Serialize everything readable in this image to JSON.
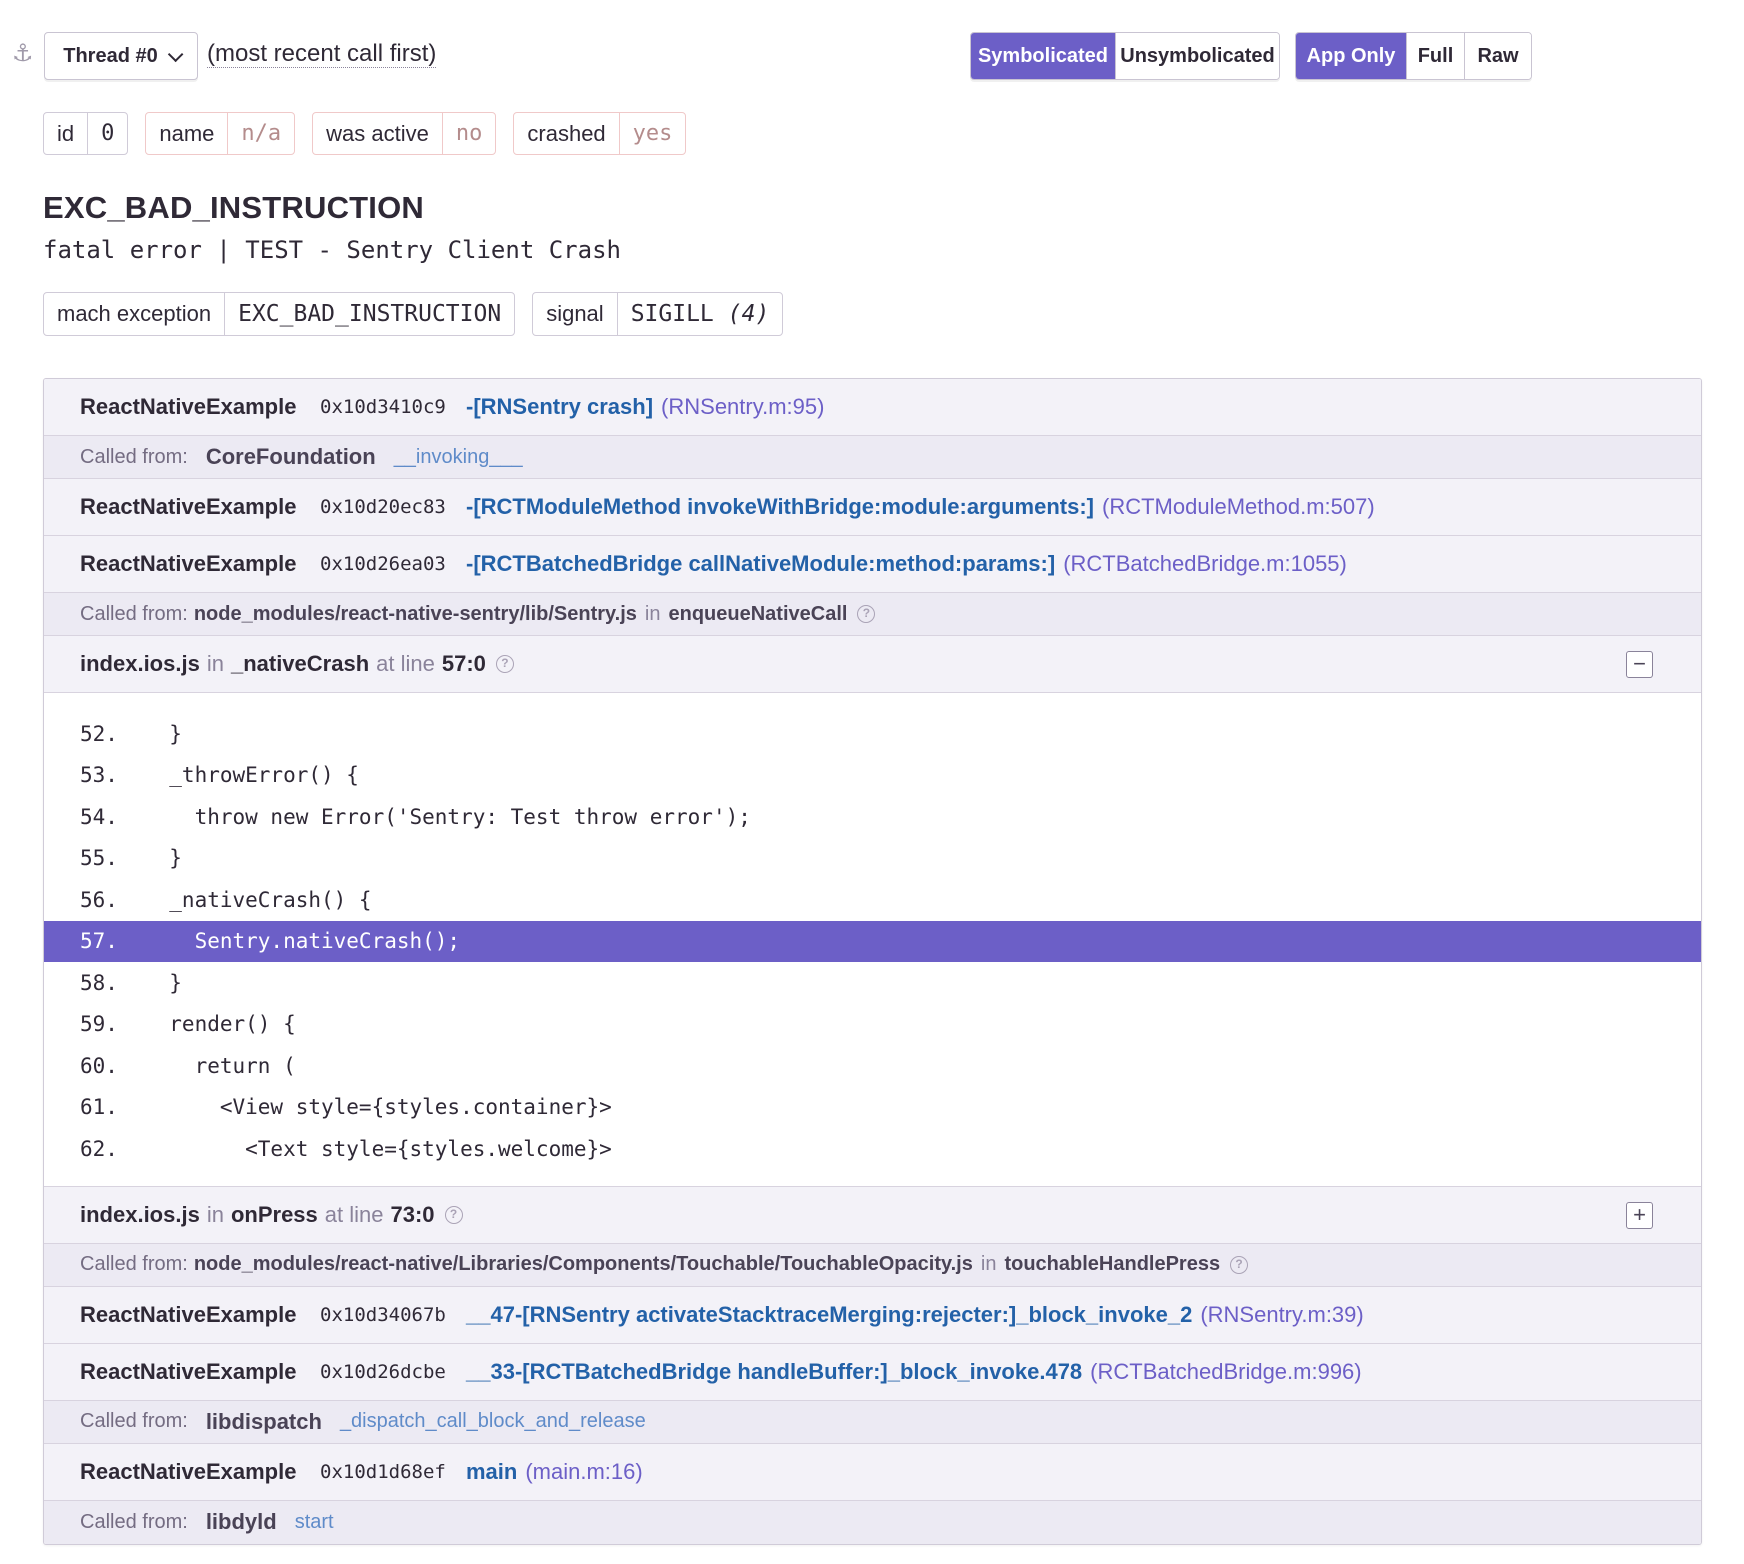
{
  "header": {
    "thread_label": "Thread #0",
    "order_note": "(most recent call first)",
    "view_modes": [
      "Symbolicated",
      "Unsymbolicated"
    ],
    "view_mode_active": "Symbolicated",
    "filter_modes": [
      "App Only",
      "Full",
      "Raw"
    ],
    "filter_mode_active": "App Only",
    "accent_color": "#6c5fc7"
  },
  "thread_info": [
    {
      "key": "id",
      "value": "0",
      "state": "plain"
    },
    {
      "key": "name",
      "value": "n/a",
      "state": "bad"
    },
    {
      "key": "was active",
      "value": "no",
      "state": "bad"
    },
    {
      "key": "crashed",
      "value": "yes",
      "state": "bad"
    }
  ],
  "exception": {
    "type": "EXC_BAD_INSTRUCTION",
    "value": "fatal error | TEST - Sentry Client Crash",
    "mechanism": [
      {
        "key": "mach exception",
        "value": "EXC_BAD_INSTRUCTION",
        "extra": ""
      },
      {
        "key": "signal",
        "value": "SIGILL",
        "extra": "(4)"
      }
    ]
  },
  "frames": {
    "called_from_label": "Called from:",
    "in_label": "in",
    "at_line_label": "at line",
    "f1": {
      "package": "ReactNativeExample",
      "address": "0x10d3410c9",
      "function": "-[RNSentry crash]",
      "location": "(RNSentry.m:95)"
    },
    "c1": {
      "package": "CoreFoundation",
      "function": "__invoking___"
    },
    "f2": {
      "package": "ReactNativeExample",
      "address": "0x10d20ec83",
      "function": "-[RCTModuleMethod invokeWithBridge:module:arguments:]",
      "location": "(RCTModuleMethod.m:507)"
    },
    "f3": {
      "package": "ReactNativeExample",
      "address": "0x10d26ea03",
      "function": "-[RCTBatchedBridge callNativeModule:method:params:]",
      "location": "(RCTBatchedBridge.m:1055)"
    },
    "c3": {
      "path": "node_modules/react-native-sentry/lib/Sentry.js",
      "function": "enqueueNativeCall"
    },
    "f4": {
      "file": "index.ios.js",
      "function": "_nativeCrash",
      "line": "57:0",
      "toggle": "−"
    },
    "code": [
      {
        "num": "52.",
        "text": "  }"
      },
      {
        "num": "53.",
        "text": "  _throwError() {"
      },
      {
        "num": "54.",
        "text": "    throw new Error('Sentry: Test throw error');"
      },
      {
        "num": "55.",
        "text": "  }"
      },
      {
        "num": "56.",
        "text": "  _nativeCrash() {"
      },
      {
        "num": "57.",
        "text": "    Sentry.nativeCrash();"
      },
      {
        "num": "58.",
        "text": "  }"
      },
      {
        "num": "59.",
        "text": "  render() {"
      },
      {
        "num": "60.",
        "text": "    return ("
      },
      {
        "num": "61.",
        "text": "      <View style={styles.container}>"
      },
      {
        "num": "62.",
        "text": "        <Text style={styles.welcome}>"
      }
    ],
    "active_line": "57.",
    "f5": {
      "file": "index.ios.js",
      "function": "onPress",
      "line": "73:0",
      "toggle": "+"
    },
    "c5": {
      "path": "node_modules/react-native/Libraries/Components/Touchable/TouchableOpacity.js",
      "function": "touchableHandlePress"
    },
    "f6": {
      "package": "ReactNativeExample",
      "address": "0x10d34067b",
      "function": "__47-[RNSentry activateStacktraceMerging:rejecter:]_block_invoke_2",
      "location": "(RNSentry.m:39)"
    },
    "f7": {
      "package": "ReactNativeExample",
      "address": "0x10d26dcbe",
      "function": "__33-[RCTBatchedBridge handleBuffer:]_block_invoke.478",
      "location": "(RCTBatchedBridge.m:996)"
    },
    "c7": {
      "package": "libdispatch",
      "function": "_dispatch_call_block_and_release"
    },
    "f8": {
      "package": "ReactNativeExample",
      "address": "0x10d1d68ef",
      "function": "main",
      "location": "(main.m:16)"
    },
    "c8": {
      "package": "libdyld",
      "function": "start"
    }
  }
}
